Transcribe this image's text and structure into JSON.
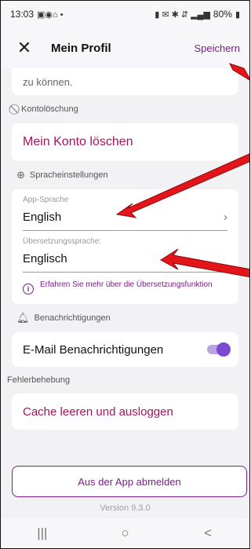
{
  "status": {
    "time": "13:03",
    "battery": "80%"
  },
  "header": {
    "title": "Mein Profil",
    "save_label": "Speichern"
  },
  "partial": {
    "text": "zu können."
  },
  "delete_section": {
    "heading": "Kontolöschung",
    "action": "Mein Konto löschen"
  },
  "language_section": {
    "heading": "Spracheinstellungen",
    "app_language_label": "App-Sprache",
    "app_language_value": "English",
    "translation_label": "Übersetzungssprache:",
    "translation_value": "Englisch",
    "info_text": "Erfahren Sie mehr über die Übersetzungsfunktion"
  },
  "notifications_section": {
    "heading": "Benachrichtigungen",
    "email_label": "E-Mail Benachrichtigungen",
    "email_enabled": true
  },
  "troubleshooting_section": {
    "heading": "Fehlerbehebung",
    "action": "Cache leeren und ausloggen"
  },
  "logout_label": "Aus der App abmelden",
  "version": "Version 9.3.0",
  "navbar": {
    "recents": "|||",
    "home": "○",
    "back": "<"
  },
  "colors": {
    "accent": "#7b1e8a",
    "danger_text": "#a4155e",
    "toggle_knob": "#7b4ad0",
    "annotation": "#e3151a"
  }
}
